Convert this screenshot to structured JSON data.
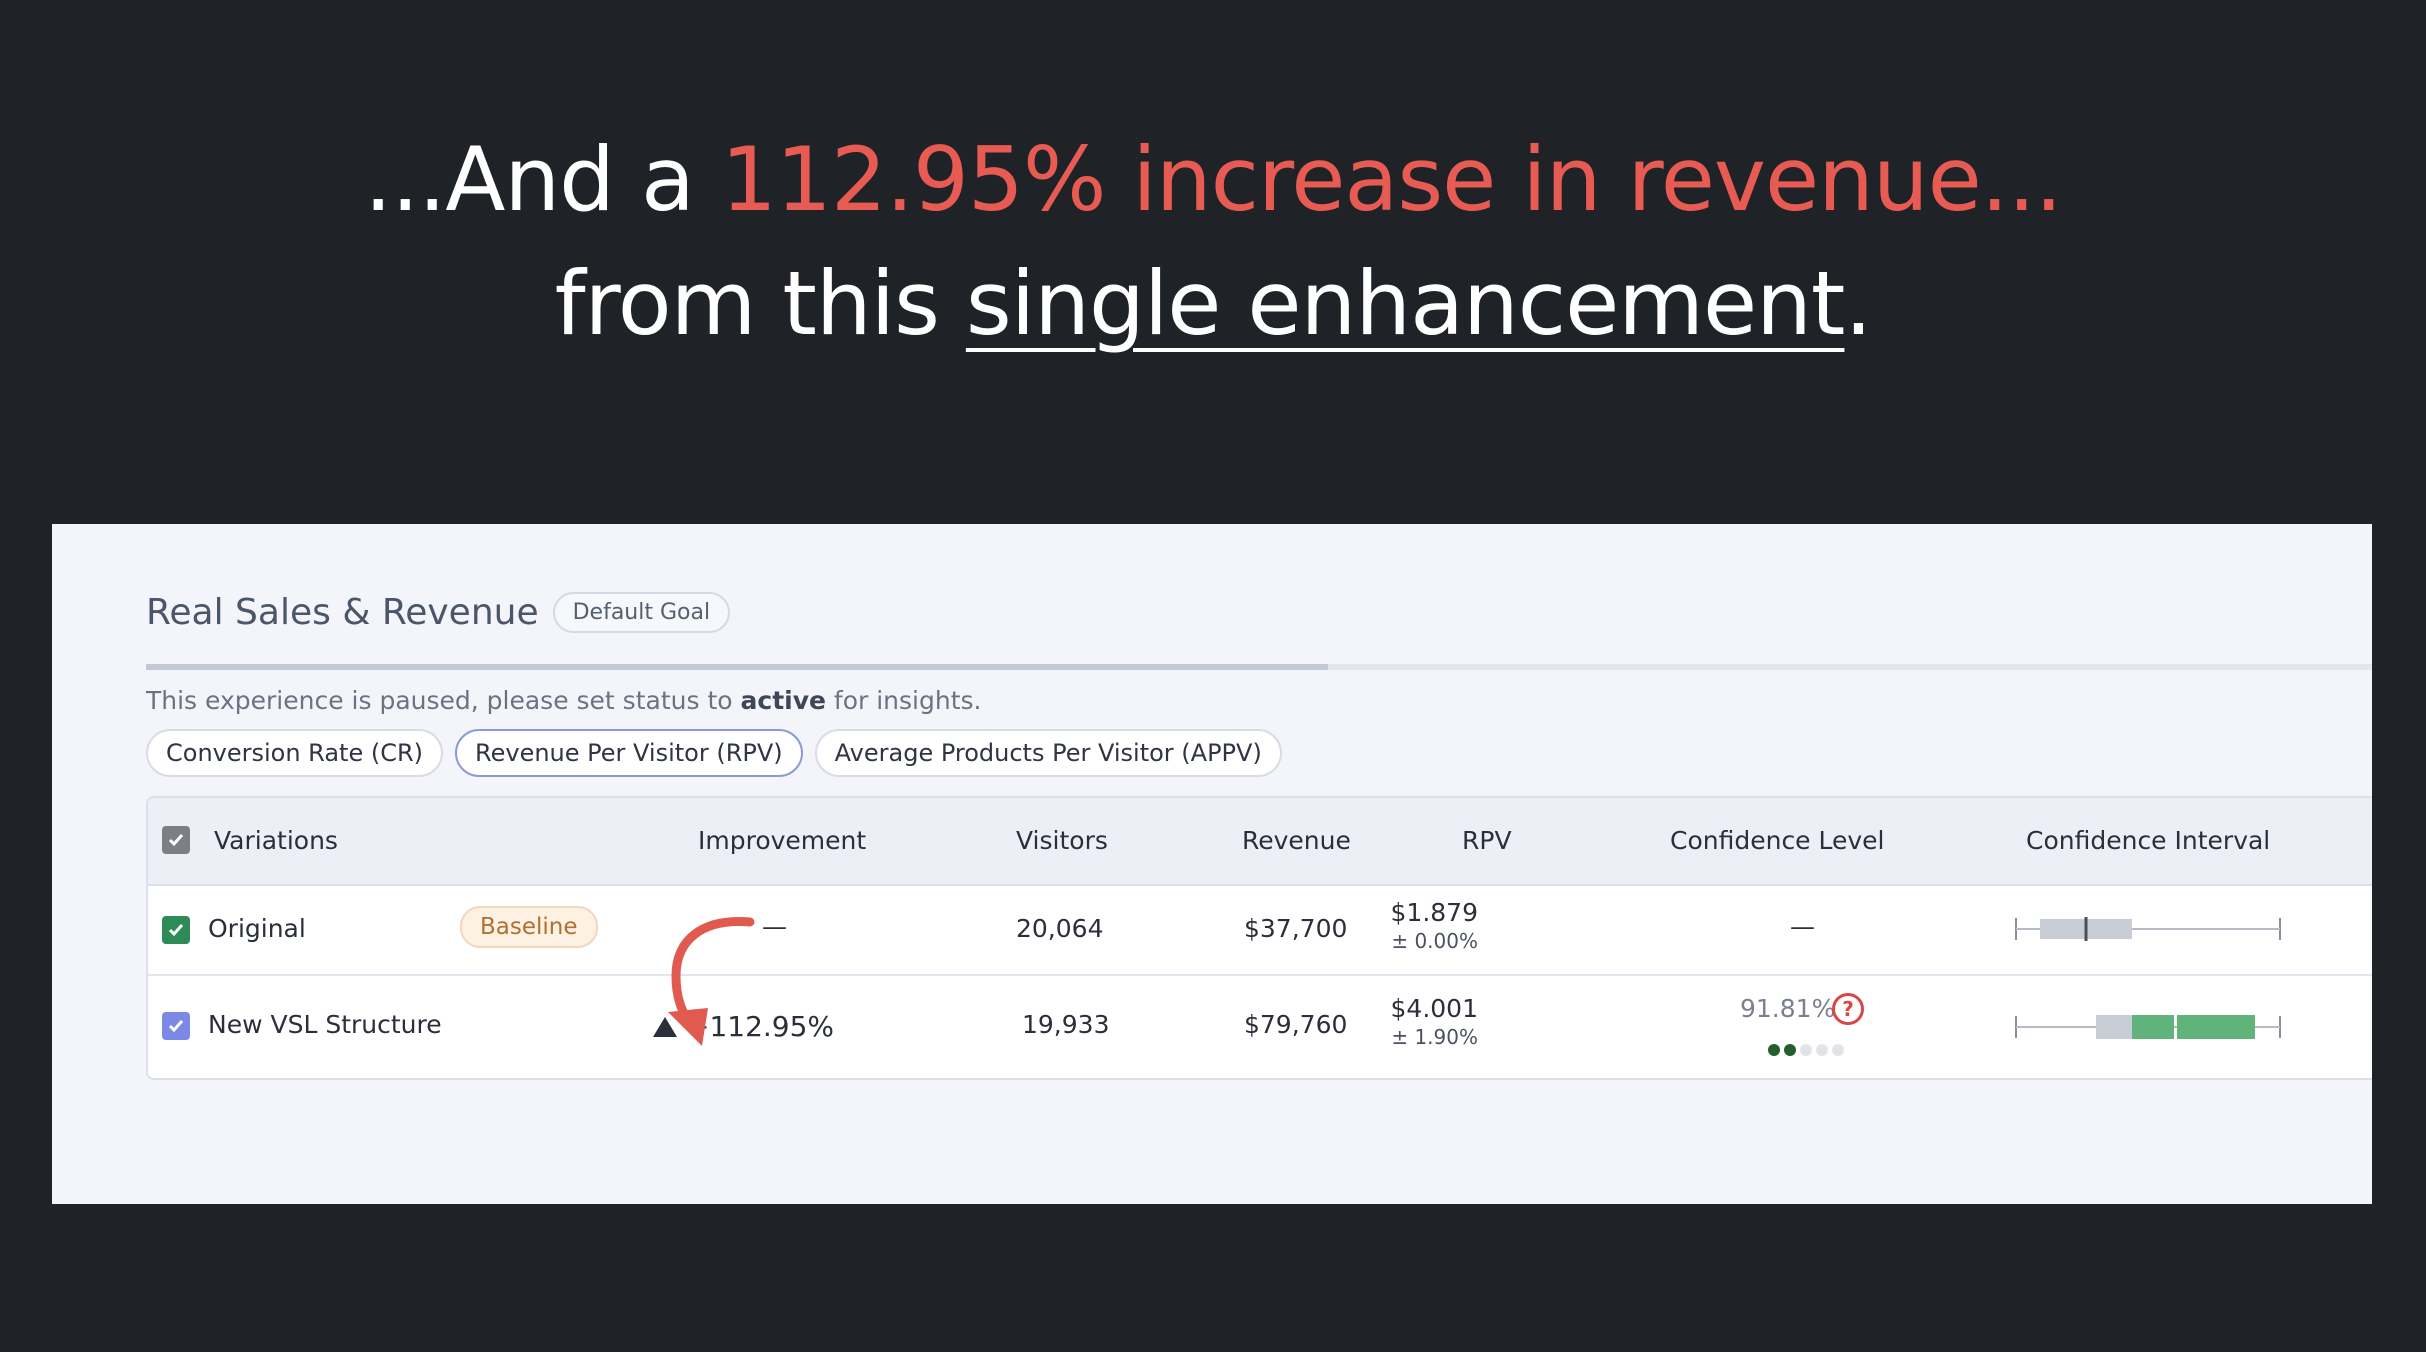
{
  "headline": {
    "line1_prefix": "...And a ",
    "line1_accent": "112.95% increase in revenue...",
    "line2_prefix": "from this ",
    "line2_underlined": "single enhancement",
    "line2_suffix": "."
  },
  "colors": {
    "background": "#1f2328",
    "accent": "#e85b52",
    "panel": "#f4f5fa",
    "ci_bar_positive": "#5fb37b",
    "ci_bar_neutral": "#c8ccd4",
    "confidence_dot_on": "#235f2a"
  },
  "goal": {
    "title": "Real Sales & Revenue",
    "badge": "Default Goal",
    "paused_prefix": "This experience is paused, please set status to ",
    "paused_bold": "active",
    "paused_suffix": " for insights."
  },
  "metric_tabs": [
    {
      "label": "Conversion Rate (CR)",
      "active": false
    },
    {
      "label": "Revenue Per Visitor (RPV)",
      "active": true
    },
    {
      "label": "Average Products Per Visitor (APPV)",
      "active": false
    }
  ],
  "table": {
    "headers": {
      "variations": "Variations",
      "improvement": "Improvement",
      "visitors": "Visitors",
      "revenue": "Revenue",
      "rpv": "RPV",
      "confidence_level": "Confidence Level",
      "confidence_interval": "Confidence Interval"
    },
    "rows": [
      {
        "name": "Original",
        "badge": "Baseline",
        "improvement": "—",
        "visitors": "20,064",
        "revenue": "$37,700",
        "rpv": "$1.879",
        "rpv_spread": "± 0.00%",
        "confidence": "—",
        "checkbox_color": "#2e8b57"
      },
      {
        "name": "New VSL Structure",
        "improvement_icon": "triangle-up-icon",
        "improvement": "+112.95%",
        "visitors": "19,933",
        "revenue": "$79,760",
        "rpv": "$4.001",
        "rpv_spread": "± 1.90%",
        "confidence": "91.81%",
        "confidence_dots_filled": 2,
        "confidence_dots_total": 5,
        "help_icon": "question-circle-icon",
        "checkbox_color": "#7b88e6"
      }
    ]
  },
  "annotation": {
    "icon": "curved-arrow-icon",
    "color": "#e05a4f"
  }
}
